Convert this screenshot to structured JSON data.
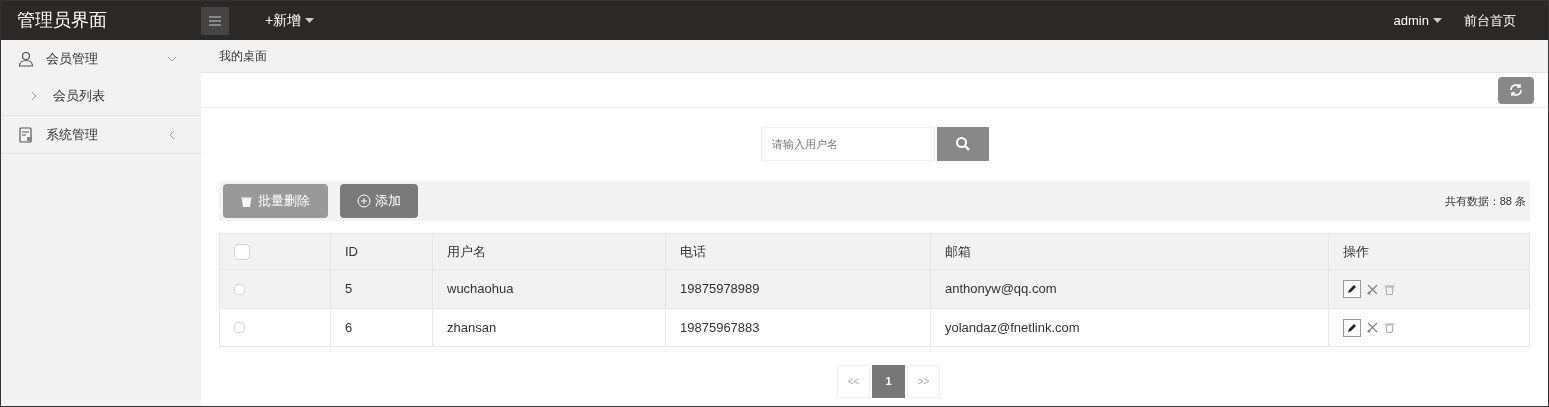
{
  "header": {
    "title": "管理员界面",
    "add_menu": "+新增",
    "user": "admin",
    "home_link": "前台首页"
  },
  "sidebar": {
    "items": [
      {
        "label": "会员管理",
        "expanded": true,
        "children": [
          {
            "label": "会员列表"
          }
        ]
      },
      {
        "label": "系统管理",
        "expanded": false
      }
    ]
  },
  "breadcrumb": "我的桌面",
  "search": {
    "placeholder": "请输入用户名"
  },
  "toolbar": {
    "delete_button": "批量删除",
    "add_button": "添加",
    "total": "共有数据：88 条"
  },
  "table": {
    "columns": [
      "",
      "ID",
      "用户名",
      "电话",
      "邮箱",
      "操作"
    ],
    "header_checked": false,
    "rows": [
      {
        "checked": false,
        "highlighted": true,
        "id": "5",
        "username": "wuchaohua",
        "phone": "19875978989",
        "email": "anthonyw@qq.com"
      },
      {
        "checked": false,
        "highlighted": false,
        "id": "6",
        "username": "zhansan",
        "phone": "19875967883",
        "email": "yolandaz@fnetlink.com"
      }
    ]
  },
  "pagination": {
    "prev": "<<",
    "next": ">>",
    "pages": [
      {
        "label": "1",
        "selected": true
      }
    ]
  }
}
